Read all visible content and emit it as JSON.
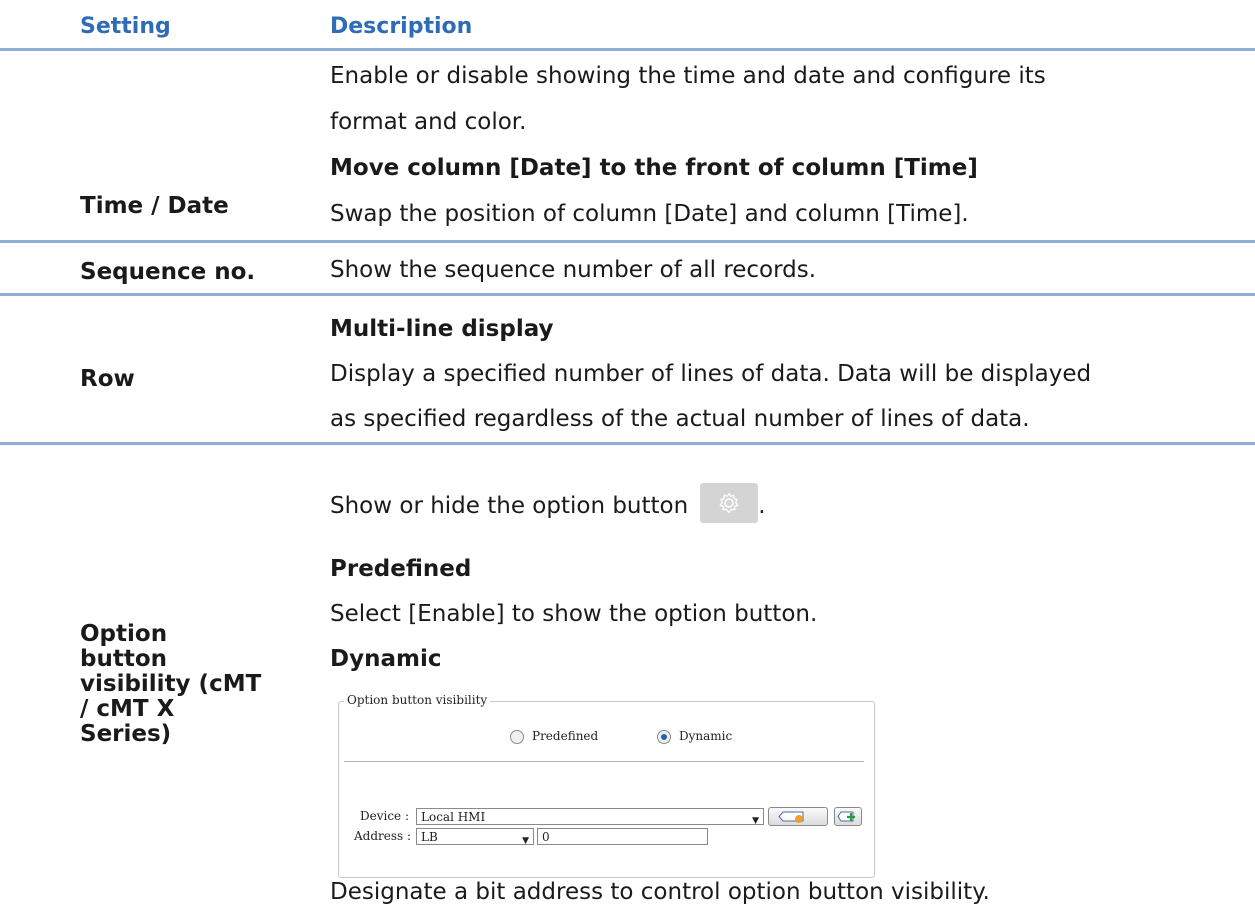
{
  "header": {
    "setting": "Setting",
    "description": "Description"
  },
  "rows": {
    "time_date": {
      "label": "Time / Date",
      "lines": [
        "Enable or disable showing the time and date and configure its",
        "format and color.",
        "Move column [Date] to the front of column [Time]",
        "Swap the position of column [Date] and column [Time]."
      ]
    },
    "sequence": {
      "label": "Sequence no.",
      "lines": [
        "Show the sequence number of all records."
      ]
    },
    "row": {
      "label": "Row",
      "lines": [
        "Multi-line display",
        "Display a specified number of lines of data. Data will be displayed",
        "as specified regardless of the actual number of lines of data."
      ]
    },
    "option": {
      "label_lines": [
        "Option",
        "button",
        "visibility (cMT",
        "/ cMT X",
        "Series)"
      ],
      "lines": [
        "Show or hide the option button",
        "Predefined",
        "Select [Enable] to show the option button.",
        "Dynamic",
        "Designate a bit address to control option button visibility."
      ],
      "period": "."
    }
  },
  "dialog": {
    "legend": "Option button visibility",
    "radio_predefined": "Predefined",
    "radio_dynamic": "Dynamic",
    "selected": "Dynamic",
    "device_label": "Device :",
    "device_value": "Local HMI",
    "address_label": "Address :",
    "address_type": "LB",
    "address_value": "0"
  },
  "icons": [
    "gear-icon",
    "radio-icon",
    "dropdown-arrow-icon",
    "address-tag-icon",
    "add-icon"
  ],
  "colors": {
    "header_text": "#2e6cb4",
    "rule": "#8faed6",
    "button_bg": "#d4d4d4"
  }
}
